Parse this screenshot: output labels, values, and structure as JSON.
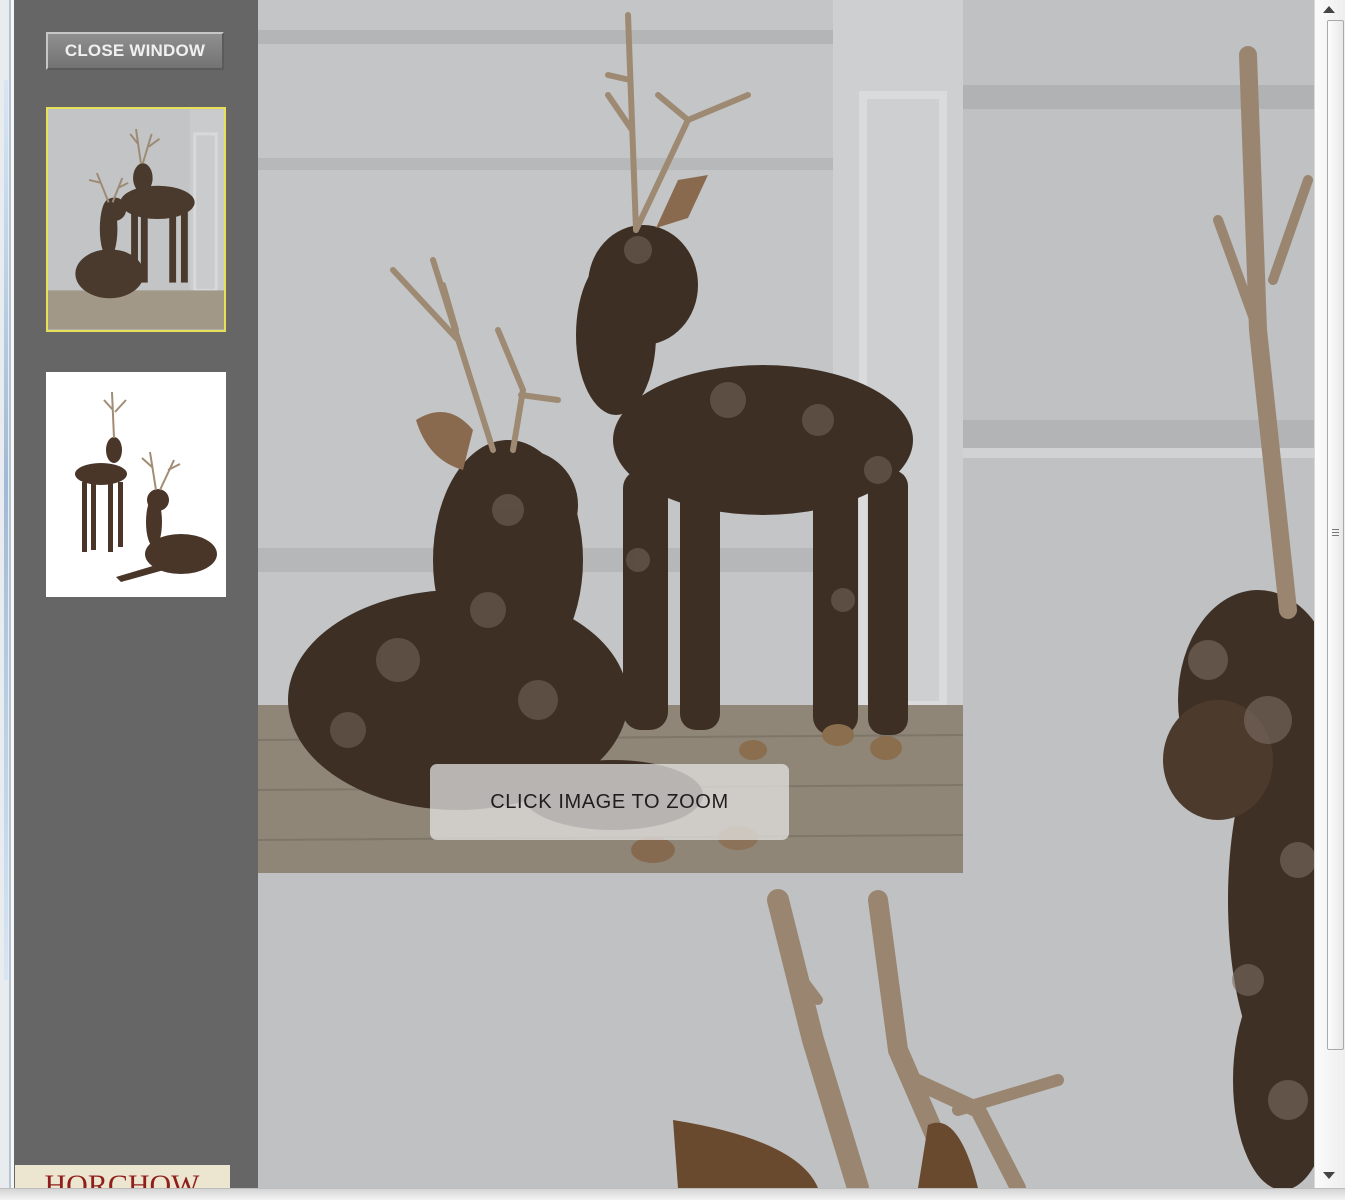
{
  "window": {
    "close_button_label": "CLOSE WINDOW"
  },
  "gallery": {
    "thumbnails": [
      {
        "name": "thumbnail-deer-room",
        "selected": true,
        "highlight_color": "#e9e05a"
      },
      {
        "name": "thumbnail-deer-white",
        "selected": false
      }
    ]
  },
  "viewer": {
    "zoom_hint": "CLICK IMAGE TO ZOOM"
  },
  "brand": {
    "logo_text": "HORCHOW"
  },
  "colors": {
    "sidebar": "#666666",
    "wall": "#c4c6c8",
    "pinecone": "#3f2f24"
  },
  "icons": {
    "scroll_up": "chevron-up-icon",
    "scroll_down": "chevron-down-icon"
  }
}
